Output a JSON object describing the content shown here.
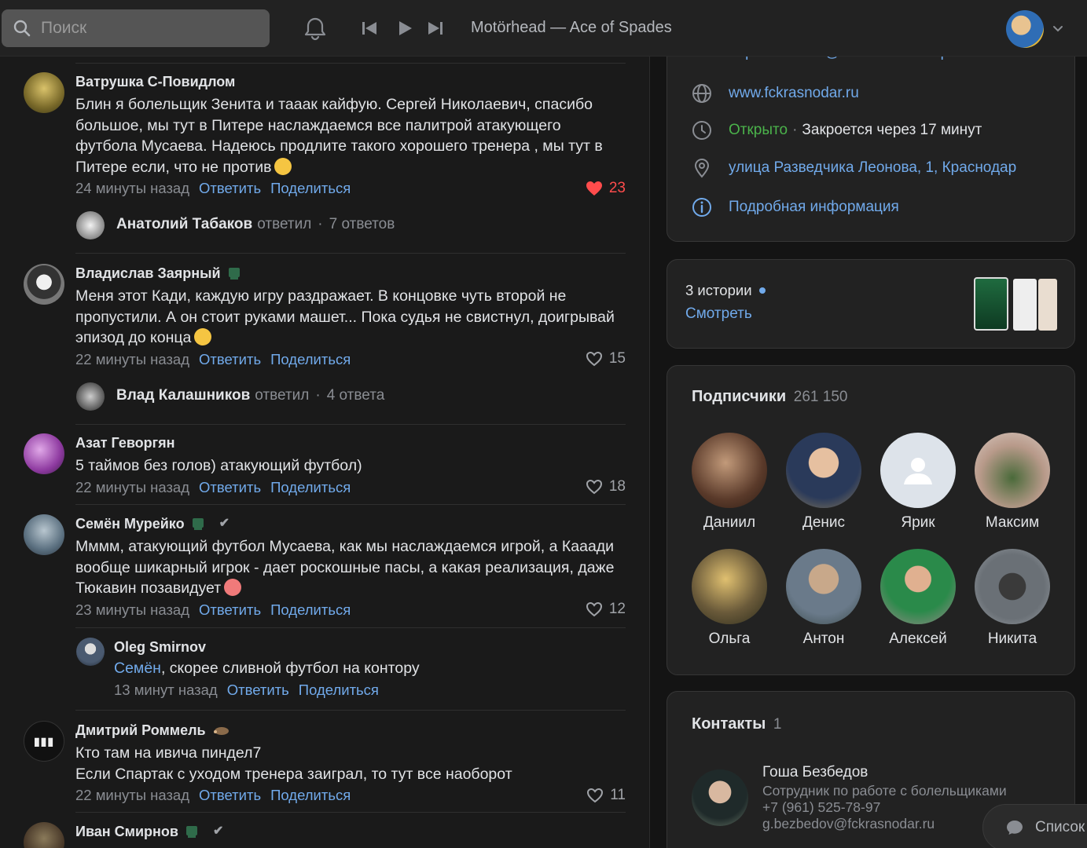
{
  "topbar": {
    "search_placeholder": "Поиск",
    "track": "Motörhead — Ace of Spades"
  },
  "comments": [
    {
      "author": "Ватрушка С-Повидлом",
      "text": "Блин я болельщик Зенита и тааак кайфую. Сергей Николаевич, спасибо большое, мы тут в Питере наслаждаемся все палитрой атакующего футбола Мусаева. Надеюсь продлите такого хорошего тренера , мы тут в Питере если, что не против",
      "time": "24 минуты назад",
      "reply": "Ответить",
      "share": "Поделиться",
      "likes": "23",
      "liked": true,
      "reply_author": "Анатолий Табаков",
      "reply_verb": "ответил",
      "reply_count": "7 ответов"
    },
    {
      "author": "Владислав Заярный",
      "text": "Меня этот Кади, каждую игру раздражает. В концовке чуть второй не пропустили. А он стоит руками машет... Пока судья не свистнул, доигрывай эпизод до конца",
      "time": "22 минуты назад",
      "reply": "Ответить",
      "share": "Поделиться",
      "likes": "15",
      "reply_author": "Влад Калашников",
      "reply_verb": "ответил",
      "reply_count": "4 ответа"
    },
    {
      "author": "Азат Геворгян",
      "text": "5 таймов без голов) атакующий футбол)",
      "time": "22 минуты назад",
      "reply": "Ответить",
      "share": "Поделиться",
      "likes": "18"
    },
    {
      "author": "Семён Мурейко",
      "text": "Мммм, атакующий футбол Мусаева, как мы наслаждаемся игрой, а Кааади вообще шикарный игрок - дает роскошные пасы, а какая реализация, даже Тюкавин позавидует",
      "time": "23 минуты назад",
      "reply": "Ответить",
      "share": "Поделиться",
      "likes": "12",
      "nested": {
        "author": "Oleg Smirnov",
        "mention": "Семён",
        "text": ", скорее сливной футбол на контору",
        "time": "13 минут назад",
        "reply": "Ответить",
        "share": "Поделиться"
      }
    },
    {
      "author": "Дмитрий Роммель",
      "text1": "Кто там на ивича пиндел7",
      "text2": "Если Спартак с уходом тренера заиграл, то тут все наоборот",
      "time": "22 минуты назад",
      "reply": "Ответить",
      "share": "Поделиться",
      "likes": "11"
    },
    {
      "author": "Иван Смирнов"
    }
  ],
  "info": {
    "vk_link": "https://vk.com/@fckrasnodar-faq",
    "site": "www.fckrasnodar.ru",
    "open": "Открыто",
    "closes": "Закроется через 17 минут",
    "address": "улица Разведчика Леонова, 1, Краснодар",
    "more": "Подробная информация"
  },
  "stories": {
    "count": "3 истории",
    "watch": "Смотреть"
  },
  "subscribers": {
    "title": "Подписчики",
    "count": "261 150",
    "people": [
      "Даниил",
      "Денис",
      "Ярик",
      "Максим",
      "Ольга",
      "Антон",
      "Алексей",
      "Никита"
    ]
  },
  "contacts": {
    "title": "Контакты",
    "count": "1",
    "name": "Гоша Безбедов",
    "role": "Сотрудник по работе с болельщиками",
    "phone": "+7 (961) 525-78-97",
    "email": "g.bezbedov@fckrasnodar.ru"
  },
  "chat_button": "Список"
}
